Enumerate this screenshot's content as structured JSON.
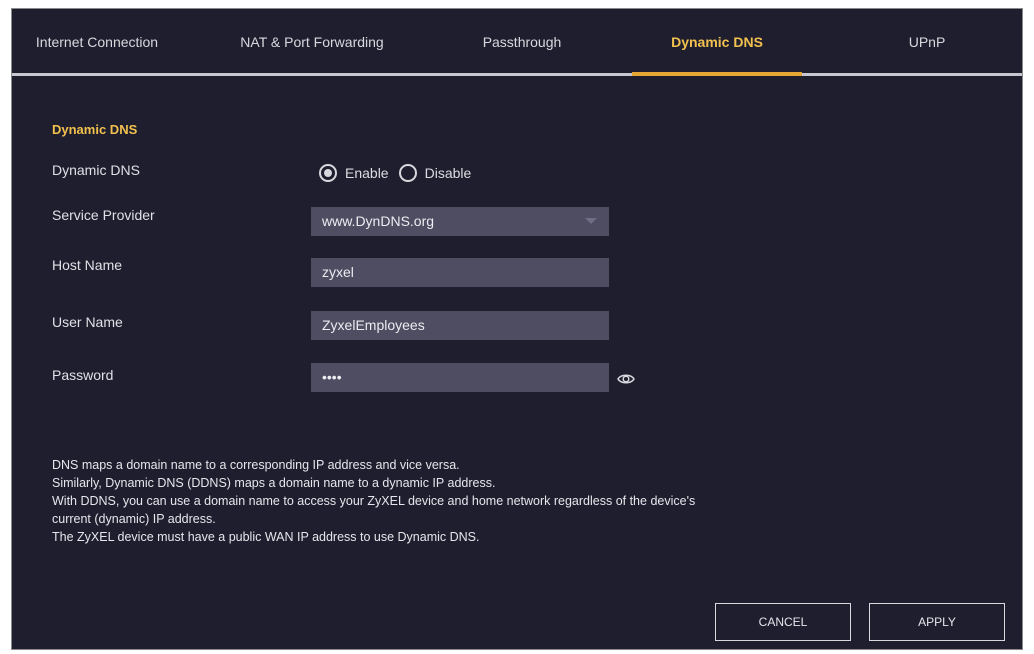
{
  "tabs": [
    {
      "label": "Internet Connection"
    },
    {
      "label": "NAT & Port Forwarding"
    },
    {
      "label": "Passthrough"
    },
    {
      "label": "Dynamic DNS",
      "active": true
    },
    {
      "label": "UPnP"
    }
  ],
  "section_title": "Dynamic DNS",
  "form": {
    "dynamic_dns": {
      "label": "Dynamic DNS",
      "options": [
        "Enable",
        "Disable"
      ],
      "selected": "Enable"
    },
    "service_provider": {
      "label": "Service Provider",
      "value": "www.DynDNS.org"
    },
    "host_name": {
      "label": "Host Name",
      "value": "zyxel"
    },
    "user_name": {
      "label": "User Name",
      "value": "ZyxelEmployees"
    },
    "password": {
      "label": "Password",
      "value": "••••"
    }
  },
  "description": [
    "DNS maps a domain name to a corresponding IP address and vice versa.",
    "Similarly, Dynamic DNS (DDNS) maps a domain name to a dynamic IP address.",
    "With DDNS, you can use a domain name to access your ZyXEL device and home network regardless of the device's",
    "current (dynamic) IP address.",
    "The ZyXEL device must have a public WAN IP address to use Dynamic DNS."
  ],
  "buttons": {
    "cancel": "CANCEL",
    "apply": "APPLY"
  },
  "colors": {
    "background": "#1f1e2e",
    "accent": "#f2c14e",
    "field": "#4e4d62"
  },
  "icons": {
    "password_toggle": "eye-icon",
    "dropdown": "chevron-down-icon"
  }
}
